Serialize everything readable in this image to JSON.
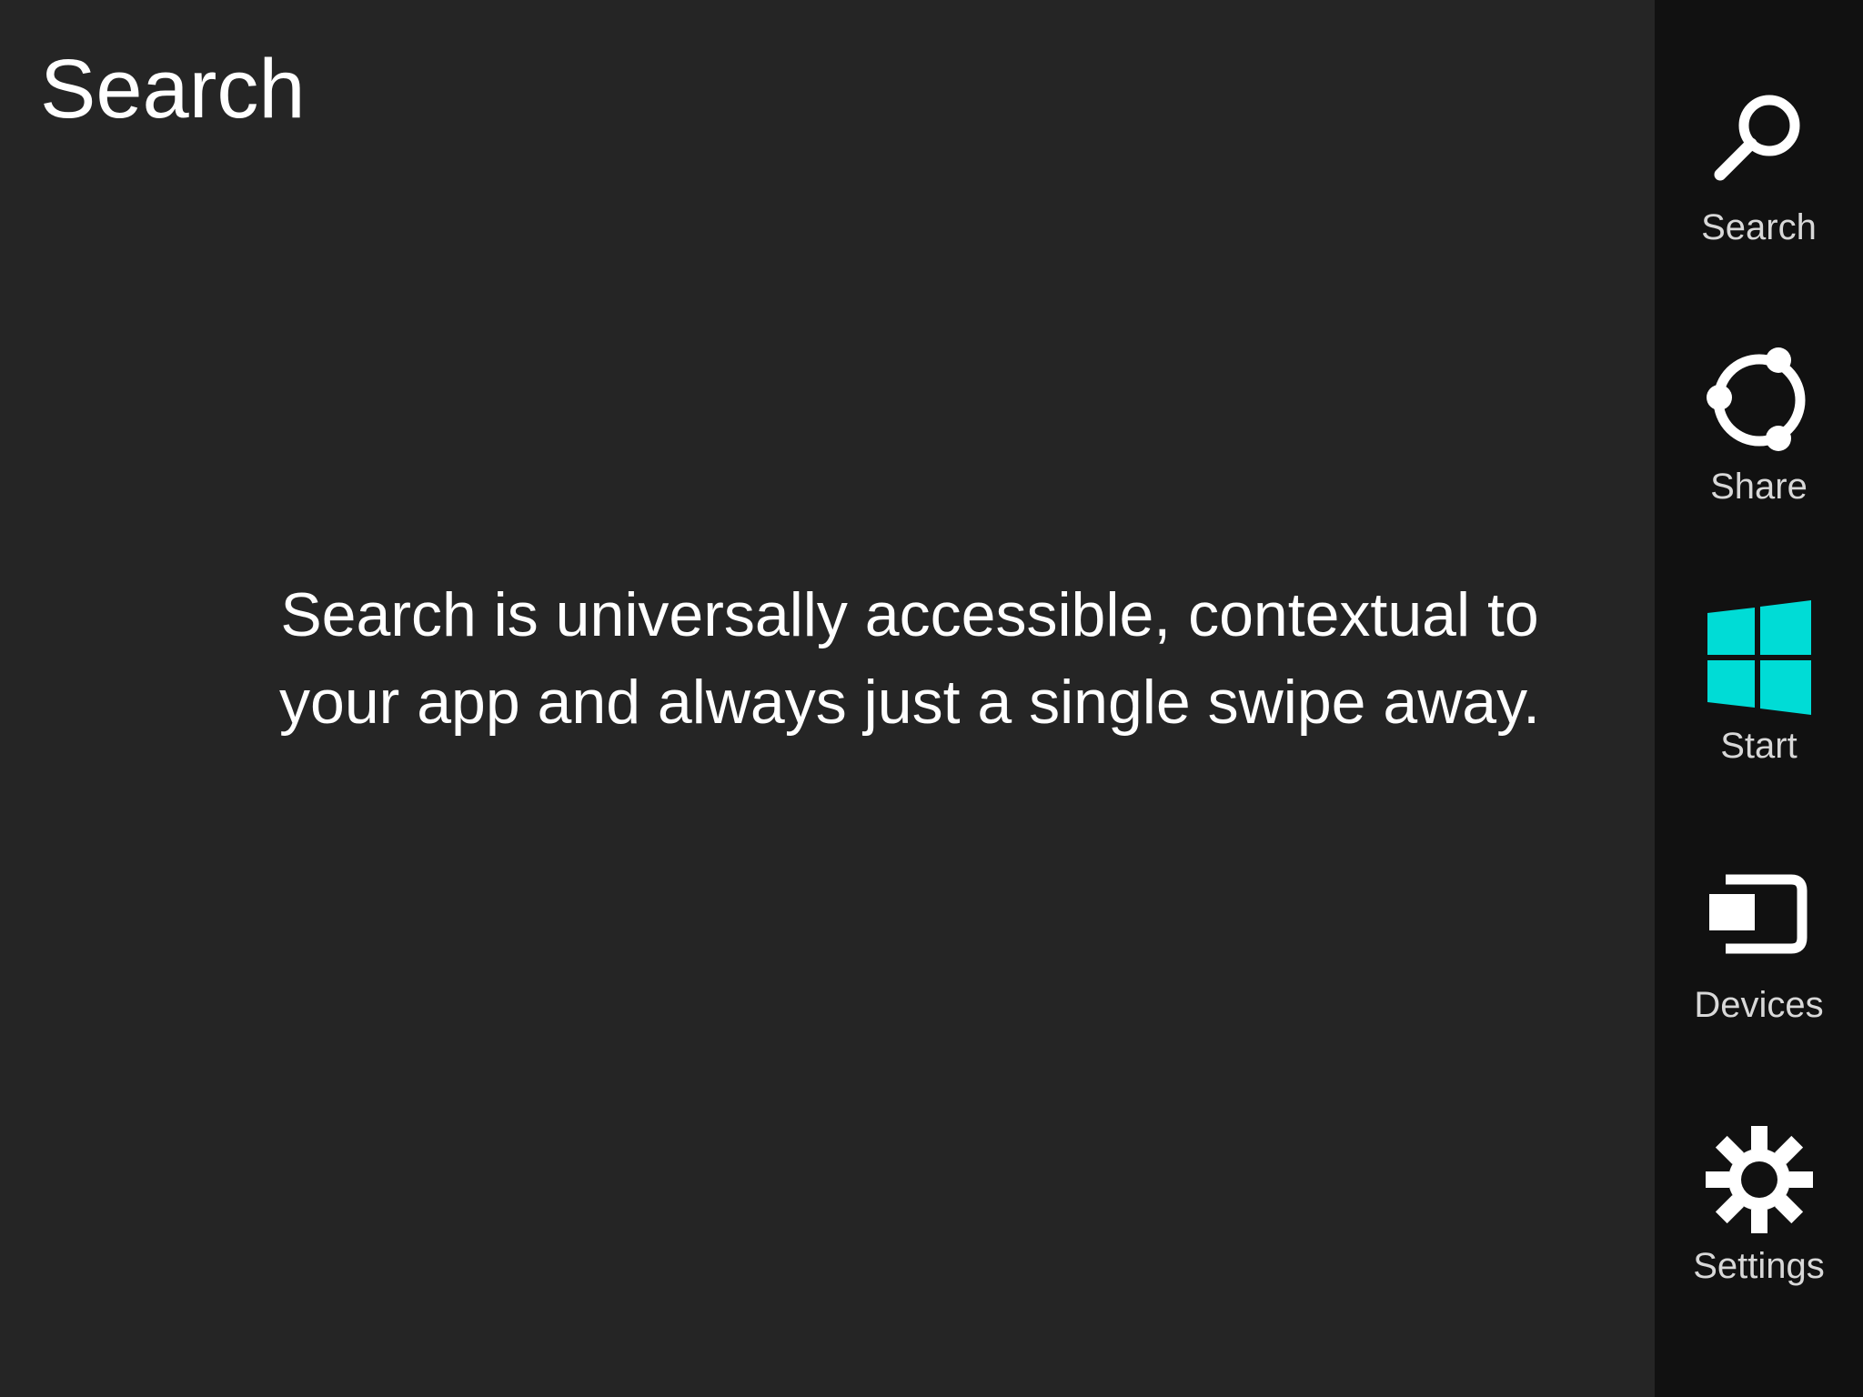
{
  "header": {
    "title": "Search"
  },
  "main": {
    "message_lines": [
      "Search is universally accessible, contextual to",
      "your app and always just a single swipe away."
    ]
  },
  "charms": {
    "items": [
      {
        "label": "Search",
        "icon": "search-icon"
      },
      {
        "label": "Share",
        "icon": "share-icon"
      },
      {
        "label": "Start",
        "icon": "windows-start-icon"
      },
      {
        "label": "Devices",
        "icon": "devices-icon"
      },
      {
        "label": "Settings",
        "icon": "gear-icon"
      }
    ]
  },
  "colors": {
    "background": "#252525",
    "charms_bar": "#111111",
    "start_accent": "#00DCD6",
    "text": "#FFFFFF",
    "charm_label": "#D8D8D8"
  }
}
